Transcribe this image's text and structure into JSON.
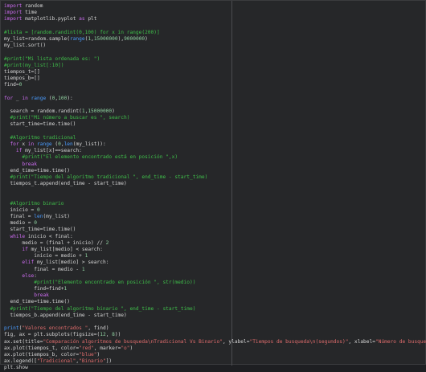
{
  "editor": {
    "lines": [
      "import random",
      "import time",
      "import matplotlib.pyplot as plt",
      "",
      "#lista = [random.randint(0,100) for x in range(200)]",
      "my_list=random.sample(range(1,15000000),9000000)",
      "my_list.sort()",
      "",
      "#print(\"Mi lista ordenada es: \")",
      "#print(my_list[:10])",
      "tiempos_t=[]",
      "tiempos_b=[]",
      "find=0",
      "",
      "for _ in range (0,100):",
      "",
      "  search = random.randint(1,15000000)",
      "  #print(\"Mi número a buscar es \", search)",
      "  start_time=time.time()",
      "",
      "  #Algoritmo tradicional",
      "  for x in range (0,len(my_list)):",
      "    if my_list[x]==search:",
      "      #print(\"El elemento encontrado está en posición \",x)",
      "      break",
      "  end_time=time.time()",
      "  #print(\"Tiempo del algoritmo tradicional \", end_time - start_time)",
      "  tiempos_t.append(end_time - start_time)",
      "",
      "",
      "  #Algoritmo binario",
      "  inicio = 0",
      "  final = len(my_list)",
      "  medio = 0",
      "  start_time=time.time()",
      "  while inicio < final:",
      "      medio = (final + inicio) // 2",
      "      if my_list[medio] < search:",
      "          inicio = medio + 1",
      "      elif my_list[medio] > search:",
      "          final = medio - 1",
      "      else:",
      "          #print(\"Elemento encontrado en posición \", str(medio))",
      "          find=find+1",
      "          break",
      "  end_time=time.time()",
      "  #print(\"Tiempo del algoritmo binario \", end_time - start_time)",
      "  tiempos_b.append(end_time - start_time)",
      "",
      "print(\"Valores encontrados \", find)",
      "fig, ax = plt.subplots(figsize=(12, 8))",
      "ax.set(title=\"Comparación algoritmos de busqueda\\nTradicional Vs Binario\", ylabel=\"Tiempos de busqueda\\n(segundos)\", xlabel=\"Número de busquedas\")",
      "ax.plot(tiempos_t, color=\"red\", marker=\"o\")",
      "ax.plot(tiempos_b, color=\"blue\")",
      "ax.legend([\"Tradicional\",\"Binario\"])",
      "plt.show"
    ]
  },
  "colors": {
    "keyword": "#cc6cf0",
    "builtin": "#4a9cff",
    "string": "#e06c6c",
    "comment": "#3fbf4a",
    "number": "#8fd0a0",
    "text": "#d6d6d6",
    "background": "#262729"
  }
}
